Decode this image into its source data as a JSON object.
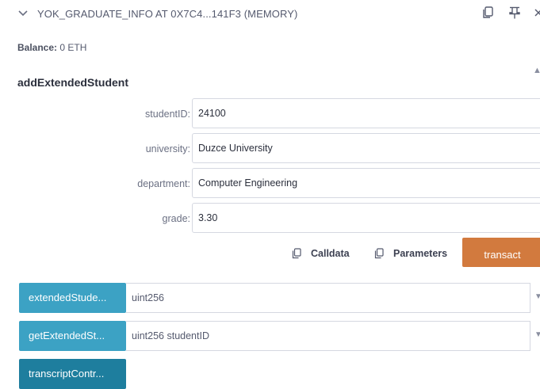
{
  "header": {
    "title": "YOK_GRADUATE_INFO AT 0X7C4...141F3 (MEMORY)",
    "icons": [
      "chevron-down-icon",
      "copy-icon",
      "pin-icon",
      "close-icon"
    ]
  },
  "balance": {
    "label": "Balance:",
    "value": "0 ETH"
  },
  "function": {
    "name": "addExtendedStudent",
    "params": [
      {
        "label": "studentID:",
        "value": "24100"
      },
      {
        "label": "university:",
        "value": "Duzce University"
      },
      {
        "label": "department:",
        "value": "Computer Engineering"
      },
      {
        "label": "grade:",
        "value": "3.30"
      }
    ],
    "calldata_label": "Calldata",
    "parameters_label": "Parameters",
    "transact_label": "transact"
  },
  "calls": [
    {
      "button": "extendedStude...",
      "placeholder": "uint256"
    },
    {
      "button": "getExtendedSt...",
      "placeholder": "uint256 studentID"
    },
    {
      "button": "transcriptContr..."
    }
  ],
  "colors": {
    "transact": "#d27a3e",
    "call_button": "#3ca2c4",
    "call_button_dark": "#1e7e9e"
  }
}
